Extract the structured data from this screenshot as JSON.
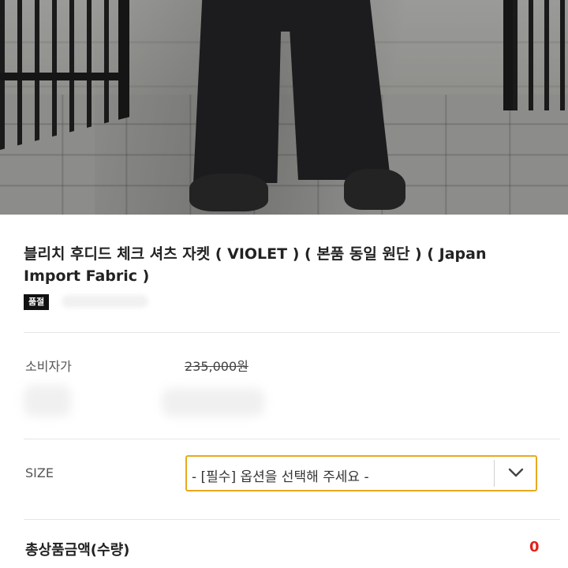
{
  "product": {
    "title_line1": "블리치 후디드 체크 셔츠 자켓 ( VIOLET ) ( 본품 동일 원단 ) ( Japan",
    "title_line2": "Import Fabric )",
    "badge": "품절"
  },
  "price": {
    "label": "소비자가",
    "original": "235,000원"
  },
  "option": {
    "label": "SIZE",
    "placeholder": "- [필수] 옵션을 선택해 주세요 -",
    "chevron_icon": "chevron-down-icon"
  },
  "total": {
    "label": "총상품금액(수량)",
    "value": "0"
  },
  "colors": {
    "select_border": "#e8a91e",
    "total_value": "#e0231c",
    "badge_bg": "#111111"
  }
}
